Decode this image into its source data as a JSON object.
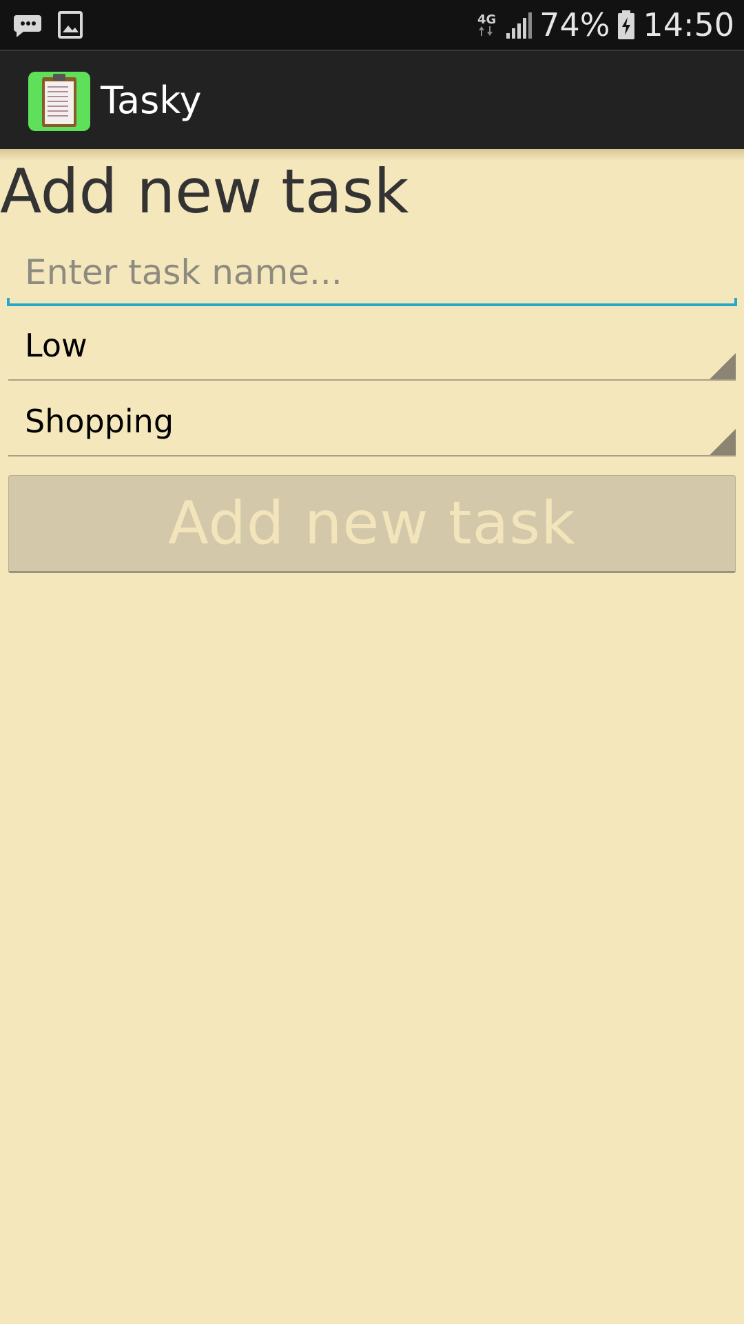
{
  "status_bar": {
    "network": "4G",
    "battery": "74%",
    "time": "14:50",
    "left_icons": [
      "message-icon",
      "image-icon"
    ],
    "right_icons": [
      "network-4g-icon",
      "signal-icon",
      "battery-charging-icon"
    ]
  },
  "action_bar": {
    "title": "Tasky",
    "icon": "clipboard-app-icon",
    "icon_color": "#5fe05a"
  },
  "form": {
    "heading": "Add new task",
    "task_name_placeholder": "Enter task name...",
    "task_name_value": "",
    "priority_selected": "Low",
    "category_selected": "Shopping",
    "submit_label": "Add new task"
  },
  "colors": {
    "background": "#f5e7bc",
    "accent": "#26a7cc",
    "button_bg": "#d3c9aa",
    "button_text": "#f2e5bc"
  }
}
